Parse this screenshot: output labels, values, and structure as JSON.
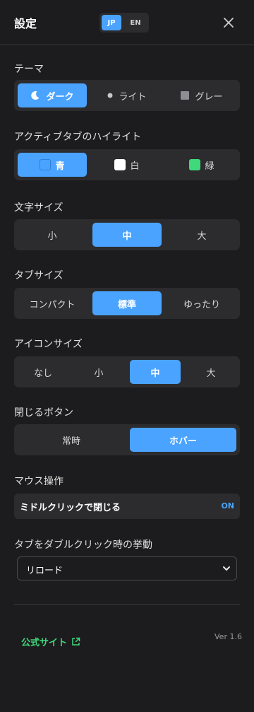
{
  "header": {
    "title": "設定",
    "lang_options": [
      "JP",
      "EN"
    ],
    "lang_selected": "JP"
  },
  "theme": {
    "label": "テーマ",
    "options": [
      "ダーク",
      "ライト",
      "グレー"
    ],
    "selected": "ダーク"
  },
  "highlight": {
    "label": "アクティブタブのハイライト",
    "options": [
      "青",
      "白",
      "緑"
    ],
    "selected": "青",
    "colors": {
      "blue": "#4aa3ff",
      "white": "#ffffff",
      "green": "#3fd97b"
    }
  },
  "font_size": {
    "label": "文字サイズ",
    "options": [
      "小",
      "中",
      "大"
    ],
    "selected": "中"
  },
  "tab_size": {
    "label": "タブサイズ",
    "options": [
      "コンパクト",
      "標準",
      "ゆったり"
    ],
    "selected": "標準"
  },
  "icon_size": {
    "label": "アイコンサイズ",
    "options": [
      "なし",
      "小",
      "中",
      "大"
    ],
    "selected": "中"
  },
  "close_button": {
    "label": "閉じるボタン",
    "options": [
      "常時",
      "ホバー"
    ],
    "selected": "ホバー"
  },
  "mouse": {
    "label": "マウス操作",
    "middle_click_label": "ミドルクリックで閉じる",
    "middle_click_value": "ON"
  },
  "dblclick": {
    "label": "タブをダブルクリック時の挙動",
    "value": "リロード"
  },
  "footer": {
    "site_label": "公式サイト",
    "version": "Ver 1.6"
  },
  "accent_color": "#4aa3ff"
}
